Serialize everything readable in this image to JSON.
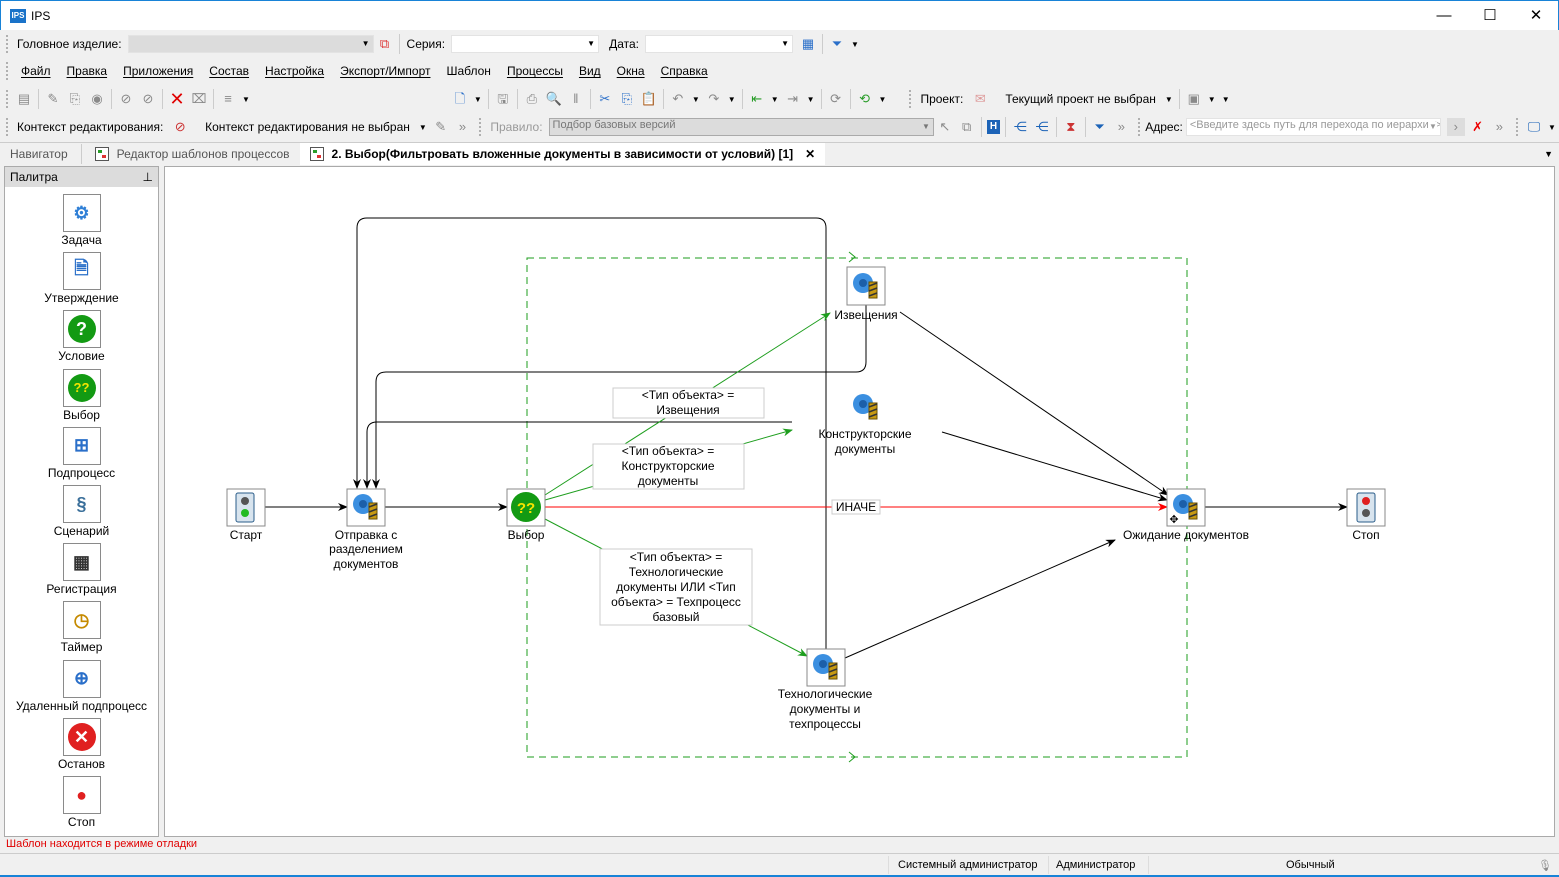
{
  "window": {
    "app_icon_text": "IPS",
    "title": "IPS",
    "minimize": "—",
    "maximize": "☐",
    "close": "✕"
  },
  "topbar": {
    "head_product_label": "Головное изделие:",
    "head_product_value": "",
    "series_label": "Серия:",
    "series_value": "",
    "date_label": "Дата:",
    "date_value": ""
  },
  "menu": [
    "Файл",
    "Правка",
    "Приложения",
    "Состав",
    "Настройка",
    "Экспорт/Импорт",
    "Шаблон",
    "Процессы",
    "Вид",
    "Окна",
    "Справка"
  ],
  "toolbar": {
    "project_label": "Проект:",
    "project_value": "Текущий проект не выбран"
  },
  "context_bar": {
    "context_label": "Контекст редактирования:",
    "context_value": "Контекст редактирования не выбран",
    "rule_label": "Правило:",
    "rule_value": "Подбор базовых версий",
    "address_label": "Адрес:",
    "address_placeholder": "<Введите здесь путь для перехода по иерархии>"
  },
  "tabs": [
    {
      "label": "Навигатор"
    },
    {
      "label": "Редактор шаблонов процессов"
    },
    {
      "label": "2. Выбор(Фильтровать вложенные документы в зависимости от условий) [1]",
      "active": true
    }
  ],
  "palette": {
    "title": "Палитра",
    "items": [
      {
        "label": "Задача",
        "icon": "gear-task-icon"
      },
      {
        "label": "Утверждение",
        "icon": "document-approve-icon"
      },
      {
        "label": "Условие",
        "icon": "question-icon"
      },
      {
        "label": "Выбор",
        "icon": "double-question-icon"
      },
      {
        "label": "Подпроцесс",
        "icon": "subprocess-icon"
      },
      {
        "label": "Сценарий",
        "icon": "script-scroll-icon"
      },
      {
        "label": "Регистрация",
        "icon": "registration-icon"
      },
      {
        "label": "Таймер",
        "icon": "clock-icon"
      },
      {
        "label": "Удаленный подпроцесс",
        "icon": "remote-subprocess-icon"
      },
      {
        "label": "Останов",
        "icon": "stop-x-icon"
      },
      {
        "label": "Стоп",
        "icon": "traffic-light-red-icon"
      }
    ]
  },
  "diagram": {
    "nodes": {
      "start": [
        "Старт"
      ],
      "send": [
        "Отправка с",
        "разделением",
        "документов"
      ],
      "choice": [
        "Выбор"
      ],
      "notices": [
        "Извещения"
      ],
      "design": [
        "Конструкторские",
        "документы"
      ],
      "tech": [
        "Технологические",
        "документы и",
        "техпроцессы"
      ],
      "wait": [
        "Ожидание документов"
      ],
      "stop": [
        "Стоп"
      ]
    },
    "conditions": {
      "notices": [
        "<Тип объекта> =",
        "Извещения"
      ],
      "design": [
        "<Тип объекта> =",
        "Конструкторские",
        "документы"
      ],
      "tech": [
        "<Тип объекта> =",
        "Технологические",
        "документы  ИЛИ  <Тип",
        "объекта> = Техпроцесс",
        "базовый"
      ],
      "else": "ИНАЧЕ"
    },
    "colors": {
      "condition_edge": "#1e9e1e",
      "else_edge": "#ff0000",
      "edge": "#000000",
      "group_border": "#1e9e1e"
    }
  },
  "status": {
    "debug_message": "Шаблон находится в режиме отладки",
    "user": "Системный администратор",
    "role": "Администратор",
    "mode": "Обычный"
  }
}
